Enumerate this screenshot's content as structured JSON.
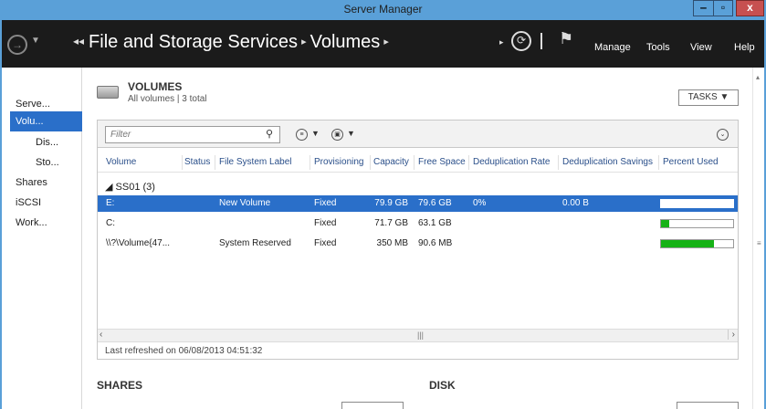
{
  "window": {
    "title": "Server Manager",
    "min_glyph": "‒",
    "max_glyph": "▫",
    "close_glyph": "x"
  },
  "header": {
    "back_glyph": "◂◂",
    "breadcrumb": [
      "File and Storage Services",
      "Volumes"
    ],
    "sep_glyph": "▸",
    "menu": {
      "manage": "Manage",
      "tools": "Tools",
      "view": "View",
      "help": "Help"
    }
  },
  "sidebar": {
    "items": [
      {
        "label": "Serve..."
      },
      {
        "label": "Volu..."
      },
      {
        "label": "Dis..."
      },
      {
        "label": "Sto..."
      },
      {
        "label": "Shares"
      },
      {
        "label": "iSCSI"
      },
      {
        "label": "Work..."
      }
    ]
  },
  "volumes": {
    "title": "VOLUMES",
    "subtitle": "All volumes | 3 total",
    "tasks_label": "TASKS",
    "filter_placeholder": "Filter",
    "columns": [
      "Volume",
      "Status",
      "File System Label",
      "Provisioning",
      "Capacity",
      "Free Space",
      "Deduplication Rate",
      "Deduplication Savings",
      "Percent Used"
    ],
    "group": "SS01 (3)",
    "rows": [
      {
        "volume": "E:",
        "status": "",
        "label": "New Volume",
        "provisioning": "Fixed",
        "capacity": "79.9 GB",
        "free": "79.6 GB",
        "dedup_rate": "0%",
        "dedup_savings": "0.00 B",
        "percent_used": 0.4
      },
      {
        "volume": "C:",
        "status": "",
        "label": "",
        "provisioning": "Fixed",
        "capacity": "71.7 GB",
        "free": "63.1 GB",
        "dedup_rate": "",
        "dedup_savings": "",
        "percent_used": 12
      },
      {
        "volume": "\\\\?\\Volume{47...",
        "status": "",
        "label": "System Reserved",
        "provisioning": "Fixed",
        "capacity": "350 MB",
        "free": "90.6 MB",
        "dedup_rate": "",
        "dedup_savings": "",
        "percent_used": 74
      }
    ],
    "refreshed": "Last refreshed on 06/08/2013 04:51:32"
  },
  "bottom": {
    "shares_title": "SHARES",
    "disk_title": "DISK"
  },
  "colors": {
    "accent": "#2a6fc9",
    "titlebar": "#5aa0d8",
    "header_bg": "#1b1b1b",
    "bar_fill": "#16b216"
  },
  "icons": [
    "navigate-circle-icon",
    "refresh-icon",
    "flag-icon",
    "volumes-tile-icon",
    "search-icon",
    "list-view-icon",
    "save-query-icon",
    "expand-icon"
  ]
}
